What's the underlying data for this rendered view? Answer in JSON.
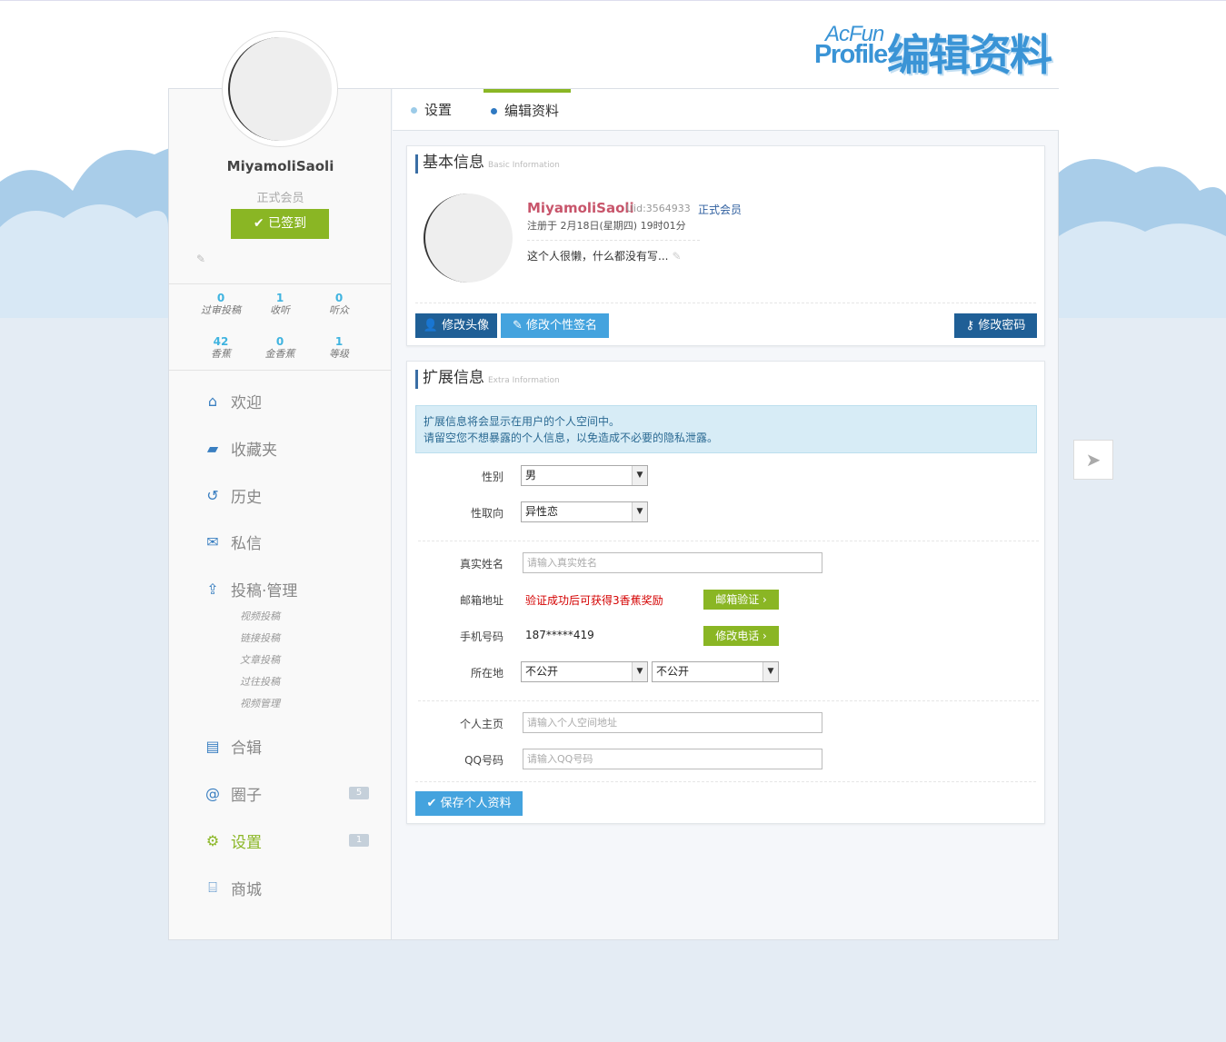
{
  "logo": {
    "acfun": "AcFun",
    "profile": "Profile",
    "title_cn": "编辑资料"
  },
  "sidebar": {
    "username": "MiyamoliSaoli",
    "role": "正式会员",
    "signin_label": "已签到",
    "stats": [
      {
        "value": "0",
        "label": "过审投稿"
      },
      {
        "value": "1",
        "label": "收听"
      },
      {
        "value": "0",
        "label": "听众"
      },
      {
        "value": "42",
        "label": "香蕉"
      },
      {
        "value": "0",
        "label": "金香蕉"
      },
      {
        "value": "1",
        "label": "等级"
      }
    ],
    "nav": [
      {
        "label": "欢迎",
        "icon": "home-icon"
      },
      {
        "label": "收藏夹",
        "icon": "folder-open-icon"
      },
      {
        "label": "历史",
        "icon": "history-icon"
      },
      {
        "label": "私信",
        "icon": "envelope-icon"
      },
      {
        "label": "投稿·管理",
        "icon": "upload-icon"
      },
      {
        "label": "合辑",
        "icon": "book-icon"
      },
      {
        "label": "圈子",
        "icon": "at-icon",
        "badge": "5"
      },
      {
        "label": "设置",
        "icon": "gear-icon",
        "badge": "1"
      },
      {
        "label": "商城",
        "icon": "gift-icon"
      }
    ],
    "sub_nav": [
      "视频投稿",
      "链接投稿",
      "文章投稿",
      "过往投稿",
      "视频管理"
    ]
  },
  "tabs": [
    {
      "label": "设置"
    },
    {
      "label": "编辑资料"
    }
  ],
  "basic": {
    "title": "基本信息",
    "title_en": "Basic Information",
    "name": "MiyamoliSaoli",
    "uid": "Uid:3564933",
    "member": "正式会员",
    "registered": "注册于 2月18日(星期四) 19时01分",
    "signature": "这个人很懒，什么都没有写...",
    "btn_avatar": "修改头像",
    "btn_signature": "修改个性签名",
    "btn_password": "修改密码"
  },
  "extra": {
    "title": "扩展信息",
    "title_en": "Extra Information",
    "notice_line1": "扩展信息将会显示在用户的个人空间中。",
    "notice_line2": "请留空您不想暴露的个人信息，以免造成不必要的隐私泄露。",
    "gender_label": "性别",
    "gender_value": "男",
    "orientation_label": "性取向",
    "orientation_value": "异性恋",
    "realname_label": "真实姓名",
    "realname_placeholder": "请输入真实姓名",
    "email_label": "邮箱地址",
    "email_hint": "验证成功后可获得3香蕉奖励",
    "email_btn": "邮箱验证 ›",
    "phone_label": "手机号码",
    "phone_value": "187*****419",
    "phone_btn": "修改电话 ›",
    "location_label": "所在地",
    "location_value1": "不公开",
    "location_value2": "不公开",
    "homepage_label": "个人主页",
    "homepage_placeholder": "请输入个人空间地址",
    "qq_label": "QQ号码",
    "qq_placeholder": "请输入QQ号码",
    "save_btn": "保存个人资料"
  },
  "colors": {
    "accent_green": "#8ab624",
    "accent_blue": "#3a94d6",
    "dark_blue": "#1f5f96",
    "name_red": "#c8556b"
  }
}
